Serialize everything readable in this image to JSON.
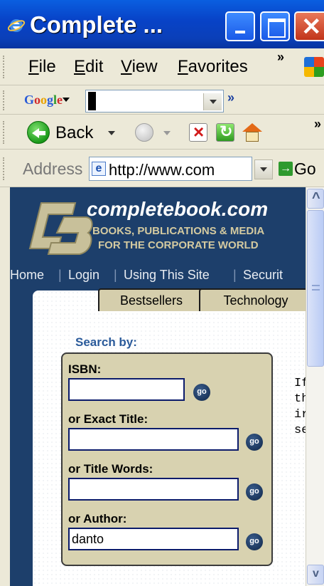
{
  "window": {
    "title": "Complete ...",
    "buttons": {
      "minimize": "minimize",
      "maximize": "maximize",
      "close": "close"
    },
    "close_glyph": "✕"
  },
  "menu": {
    "items": [
      "File",
      "Edit",
      "View",
      "Favorites"
    ],
    "overflow": "»"
  },
  "google_toolbar": {
    "logo": "Google",
    "search_value": "",
    "overflow": "»"
  },
  "toolbar": {
    "back_label": "Back",
    "overflow": "»"
  },
  "address": {
    "label": "Address",
    "url": "http://www.com",
    "go_label": "Go",
    "go_glyph": "→"
  },
  "site": {
    "name": "completebook.com",
    "tagline_line1": "BOOKS, PUBLICATIONS & MEDIA",
    "tagline_line2": "FOR THE CORPORATE WORLD",
    "nav": [
      "Home",
      "Login",
      "Using This Site",
      "Securit"
    ],
    "nav_sep": "|",
    "tabs": [
      "Bestsellers",
      "Technology"
    ],
    "search": {
      "title": "Search by:",
      "fields": [
        {
          "label": "ISBN:",
          "value": ""
        },
        {
          "label": "or Exact Title:",
          "value": ""
        },
        {
          "label": "or Title Words:",
          "value": ""
        },
        {
          "label": "or Author:",
          "value": "danto"
        }
      ],
      "go_label": "go"
    },
    "side_text": [
      "If",
      "th",
      "ir",
      "se"
    ]
  },
  "colors": {
    "titlebar": "#0843c8",
    "site_bg": "#1d3f6b",
    "search_bg": "#d8d2b0",
    "accent_text": "#2a5a9a"
  }
}
